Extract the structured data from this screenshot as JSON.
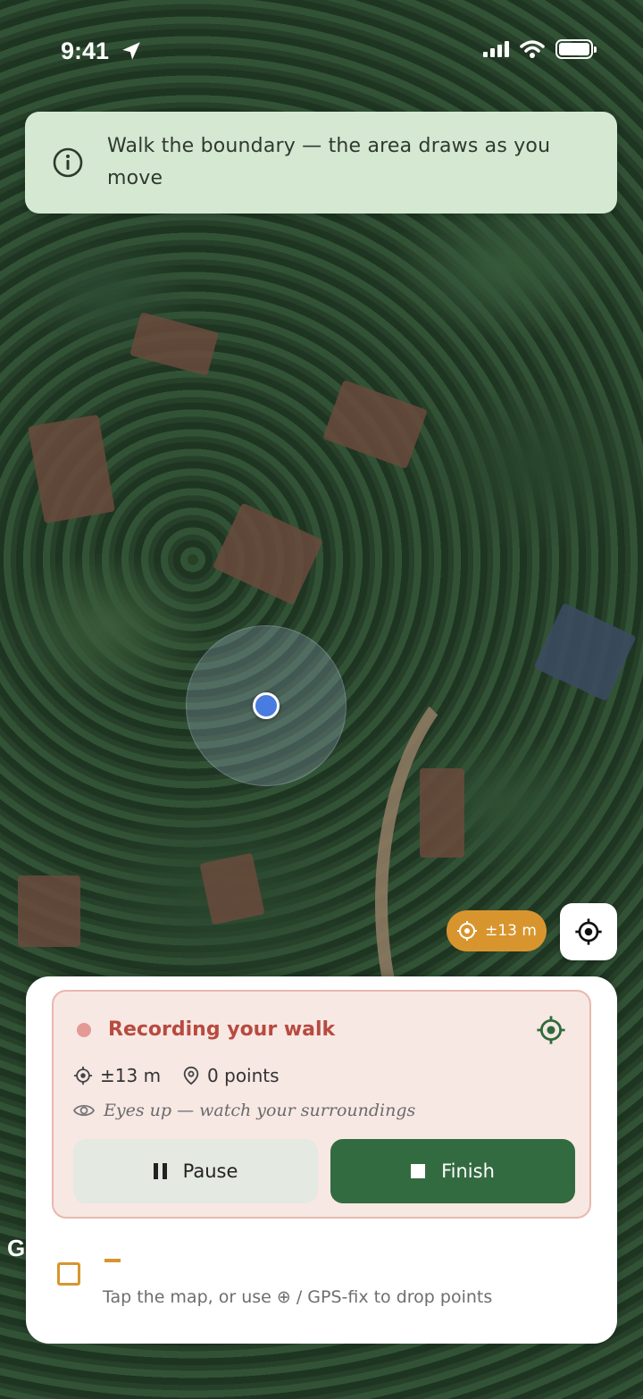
{
  "status_bar": {
    "time": "9:41",
    "icons": [
      "location-arrow-icon",
      "signal-icon",
      "wifi-icon",
      "battery-icon"
    ]
  },
  "banner": {
    "icon": "info-icon",
    "text": "Walk the boundary — the area draws as you move"
  },
  "map": {
    "accuracy_chip": {
      "icon": "target-icon",
      "label": "±13 m"
    },
    "locate_button": {
      "icon": "crosshair-icon"
    },
    "google_mark": "G"
  },
  "recording": {
    "title": "Recording your walk",
    "accuracy": "±13 m",
    "points": "0 points",
    "hint": "Eyes up — watch your surroundings",
    "pause_label": "Pause",
    "finish_label": "Finish"
  },
  "footer": {
    "hint": "Tap the map, or use ⊕ / GPS-fix to drop points"
  },
  "colors": {
    "banner_bg": "#d4e8d2",
    "accent_orange": "#d8952e",
    "recording_red": "#b84a3f",
    "finish_green": "#336b40",
    "location_blue": "#4a7be0"
  }
}
